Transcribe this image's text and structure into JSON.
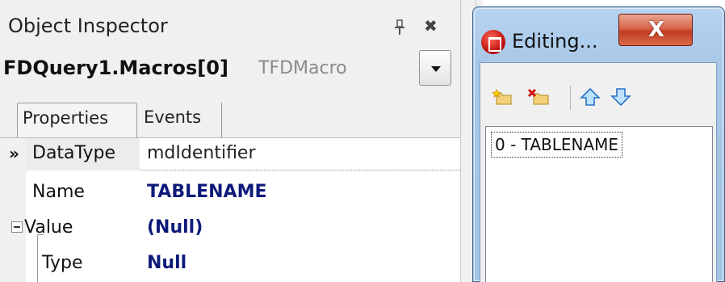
{
  "object_inspector": {
    "title": "Object Inspector",
    "selected_object": "FDQuery1.Macros[0]",
    "selected_class": "TFDMacro",
    "tabs": [
      {
        "label": "Properties"
      },
      {
        "label": "Events"
      }
    ],
    "properties": [
      {
        "name": "DataType",
        "value": "mdIdentifier"
      },
      {
        "name": "Name",
        "value": "TABLENAME"
      },
      {
        "name": "Value",
        "value": "(Null)"
      },
      {
        "name": "Type",
        "value": "Null"
      }
    ],
    "icons": {
      "pin": "pin-icon",
      "close": "close-icon",
      "selected_row": "double-chevron-right-icon",
      "collapse": "collapse-minus-icon",
      "dropdown": "chevron-down-icon"
    }
  },
  "editing_window": {
    "title": "Editing...",
    "close_label": "X",
    "toolbar": [
      "add-new-icon",
      "delete-icon",
      "move-up-icon",
      "move-down-icon"
    ],
    "items": [
      "0 - TABLENAME"
    ]
  },
  "colors": {
    "value_blue": "#0e1a7a",
    "titlebar_blue": "#b6d3f0",
    "close_red": "#c23d22"
  }
}
